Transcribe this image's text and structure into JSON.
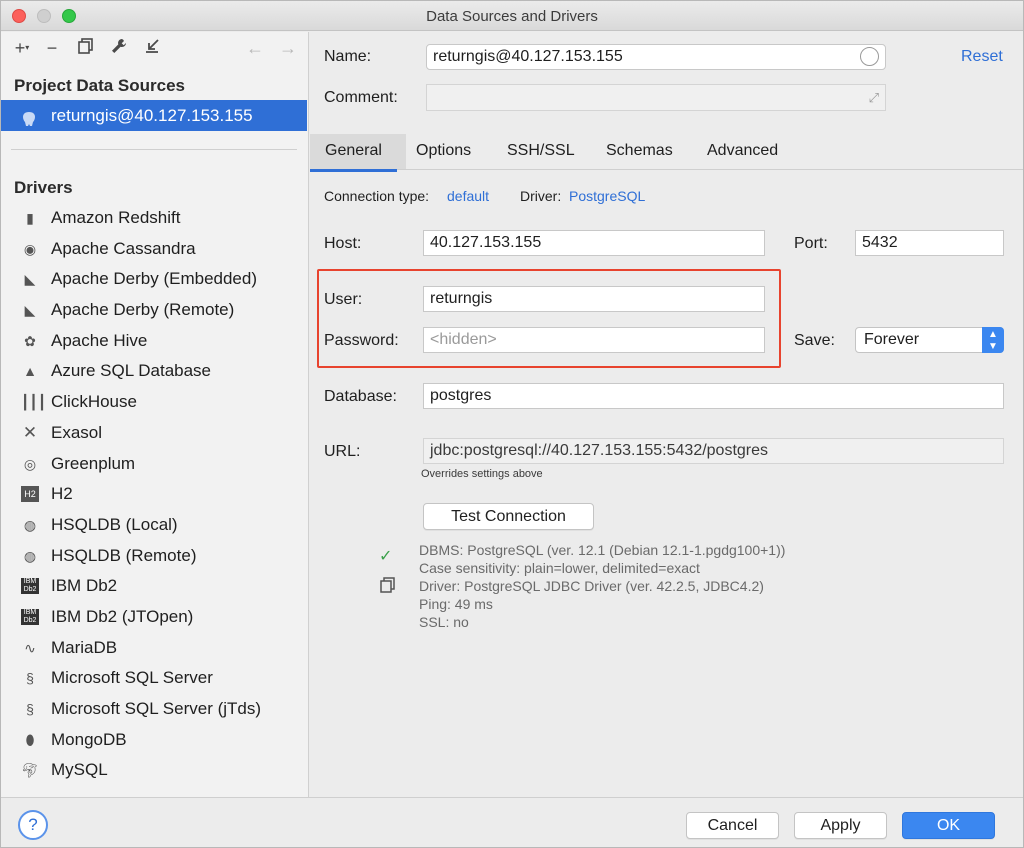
{
  "window": {
    "title": "Data Sources and Drivers"
  },
  "sidebar": {
    "project_heading": "Project Data Sources",
    "data_source": "returngis@40.127.153.155",
    "drivers_heading": "Drivers",
    "drivers": [
      {
        "label": "Amazon Redshift",
        "icon": "redshift-icon"
      },
      {
        "label": "Apache Cassandra",
        "icon": "cassandra-icon"
      },
      {
        "label": "Apache Derby (Embedded)",
        "icon": "derby-icon"
      },
      {
        "label": "Apache Derby (Remote)",
        "icon": "derby-icon"
      },
      {
        "label": "Apache Hive",
        "icon": "hive-icon"
      },
      {
        "label": "Azure SQL Database",
        "icon": "azure-icon"
      },
      {
        "label": "ClickHouse",
        "icon": "clickhouse-icon"
      },
      {
        "label": "Exasol",
        "icon": "exasol-icon"
      },
      {
        "label": "Greenplum",
        "icon": "greenplum-icon"
      },
      {
        "label": "H2",
        "icon": "h2-icon"
      },
      {
        "label": "HSQLDB (Local)",
        "icon": "hsqldb-icon"
      },
      {
        "label": "HSQLDB (Remote)",
        "icon": "hsqldb-icon"
      },
      {
        "label": "IBM Db2",
        "icon": "db2-icon"
      },
      {
        "label": "IBM Db2 (JTOpen)",
        "icon": "db2-icon"
      },
      {
        "label": "MariaDB",
        "icon": "mariadb-icon"
      },
      {
        "label": "Microsoft SQL Server",
        "icon": "sqlserver-icon"
      },
      {
        "label": "Microsoft SQL Server (jTds)",
        "icon": "sqlserver-icon"
      },
      {
        "label": "MongoDB",
        "icon": "mongodb-icon"
      },
      {
        "label": "MySQL",
        "icon": "mysql-icon"
      }
    ]
  },
  "main": {
    "name_label": "Name:",
    "name_value": "returngis@40.127.153.155",
    "reset_label": "Reset",
    "comment_label": "Comment:",
    "comment_value": "",
    "tabs": [
      "General",
      "Options",
      "SSH/SSL",
      "Schemas",
      "Advanced"
    ],
    "connection_type_label": "Connection type:",
    "connection_type_value": "default",
    "driver_label": "Driver:",
    "driver_value": "PostgreSQL",
    "host_label": "Host:",
    "host_value": "40.127.153.155",
    "port_label": "Port:",
    "port_value": "5432",
    "user_label": "User:",
    "user_value": "returngis",
    "password_label": "Password:",
    "password_placeholder": "<hidden>",
    "save_label": "Save:",
    "save_value": "Forever",
    "database_label": "Database:",
    "database_value": "postgres",
    "url_label": "URL:",
    "url_value": "jdbc:postgresql://40.127.153.155:5432/postgres",
    "url_note": "Overrides settings above",
    "test_button": "Test Connection",
    "status_lines": [
      "DBMS: PostgreSQL (ver. 12.1 (Debian 12.1-1.pgdg100+1))",
      "Case sensitivity: plain=lower, delimited=exact",
      "Driver: PostgreSQL JDBC Driver (ver. 42.2.5, JDBC4.2)",
      "Ping: 49 ms",
      "SSL: no"
    ]
  },
  "footer": {
    "help": "?",
    "cancel": "Cancel",
    "apply": "Apply",
    "ok": "OK"
  },
  "colors": {
    "accent": "#2f6fd6",
    "highlight_box": "#e8432e",
    "success": "#3aa04a"
  }
}
